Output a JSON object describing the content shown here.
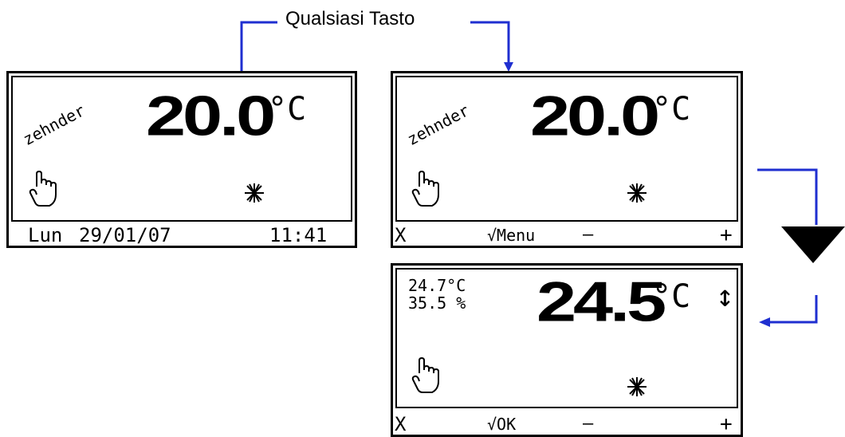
{
  "caption": "Qualsiasi Tasto",
  "colors": {
    "connector": "#1f2fd0",
    "ink": "#000000",
    "background": "#ffffff"
  },
  "screens": [
    {
      "brand": "zehnder",
      "temperature": "20.0",
      "unit": "°C",
      "footer": {
        "day": "Lun",
        "date": "29/01/07",
        "time": "11:41"
      },
      "icons": [
        "hand-icon",
        "fan-icon"
      ]
    },
    {
      "brand": "zehnder",
      "temperature": "20.0",
      "unit": "°C",
      "footer": {
        "cancel": "X",
        "menu": "√Menu",
        "minus": "—",
        "plus": "+"
      },
      "icons": [
        "hand-icon",
        "fan-icon"
      ]
    },
    {
      "measured_temp": "24.7°C",
      "humidity": "35.5 %",
      "temperature": "24.5",
      "unit": "°C",
      "adjust_arrow": "↕",
      "footer": {
        "cancel": "X",
        "ok": "√OK",
        "minus": "—",
        "plus": "+"
      },
      "icons": [
        "hand-icon",
        "fan-icon",
        "up-down-arrow-icon"
      ]
    }
  ]
}
